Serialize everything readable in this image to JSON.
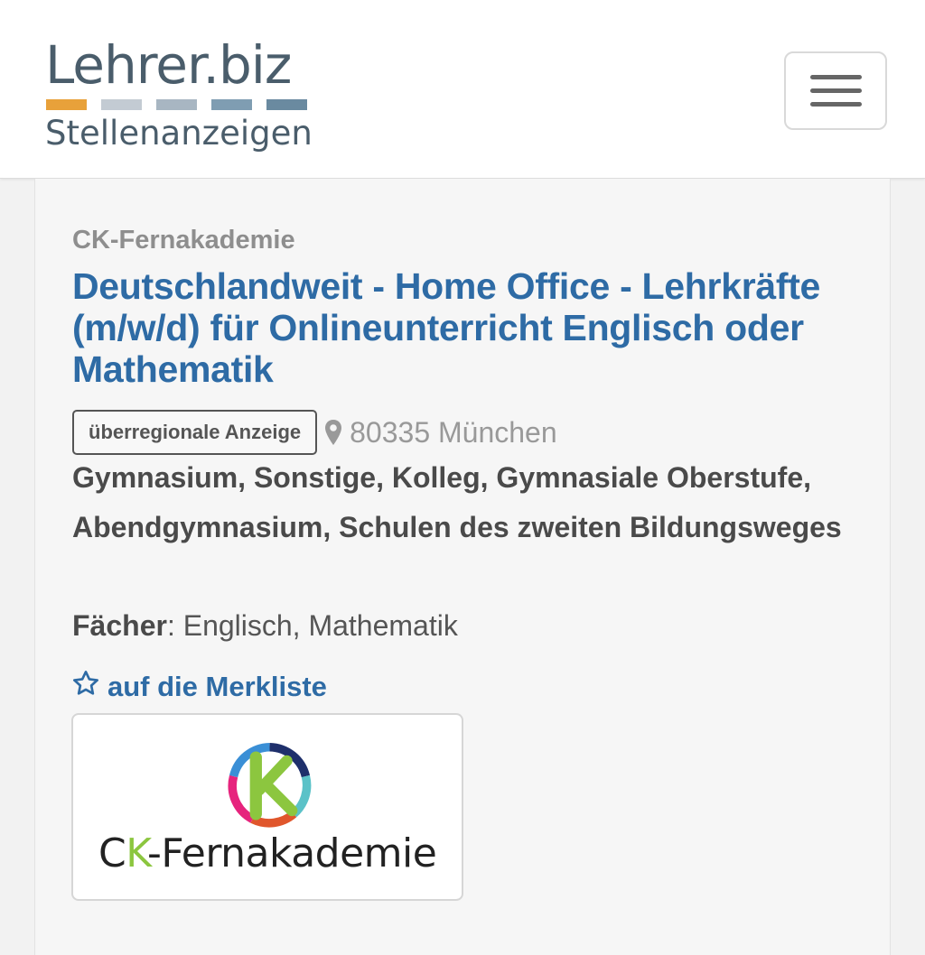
{
  "header": {
    "logo_top": "Lehrer.biz",
    "logo_bottom": "Stellenanzeigen",
    "logo_bar_colors": [
      "#e8a13a",
      "#c3cbd3",
      "#a8b6c2",
      "#7f9db2",
      "#6a8aa0"
    ],
    "menu_icon": "hamburger-icon"
  },
  "job": {
    "company": "CK-Fernakademie",
    "title": "Deutschlandweit - Home Office - Lehrkräfte (m/w/d) für Onlineunterricht Englisch oder Mathematik",
    "badge": "überregionale Anzeige",
    "location_icon": "map-pin-icon",
    "location": "80335 München",
    "schools": "Gymnasium, Sonstige, Kolleg, Gymnasiale Oberstufe, Abendgymnasium, Schulen des zweiten Bildungsweges",
    "faecher_label": "Fächer",
    "faecher_sep": ":",
    "faecher_value": " Englisch, Mathematik",
    "merkliste_icon": "star-icon",
    "merkliste_label": "auf die Merkliste",
    "company_logo": {
      "text_prefix": "C",
      "text_k": "K",
      "text_suffix": "-Fernakademie"
    }
  },
  "colors": {
    "accent": "#2e6ba5",
    "muted": "#8e8e8e",
    "brand_green": "#8cc63f"
  }
}
